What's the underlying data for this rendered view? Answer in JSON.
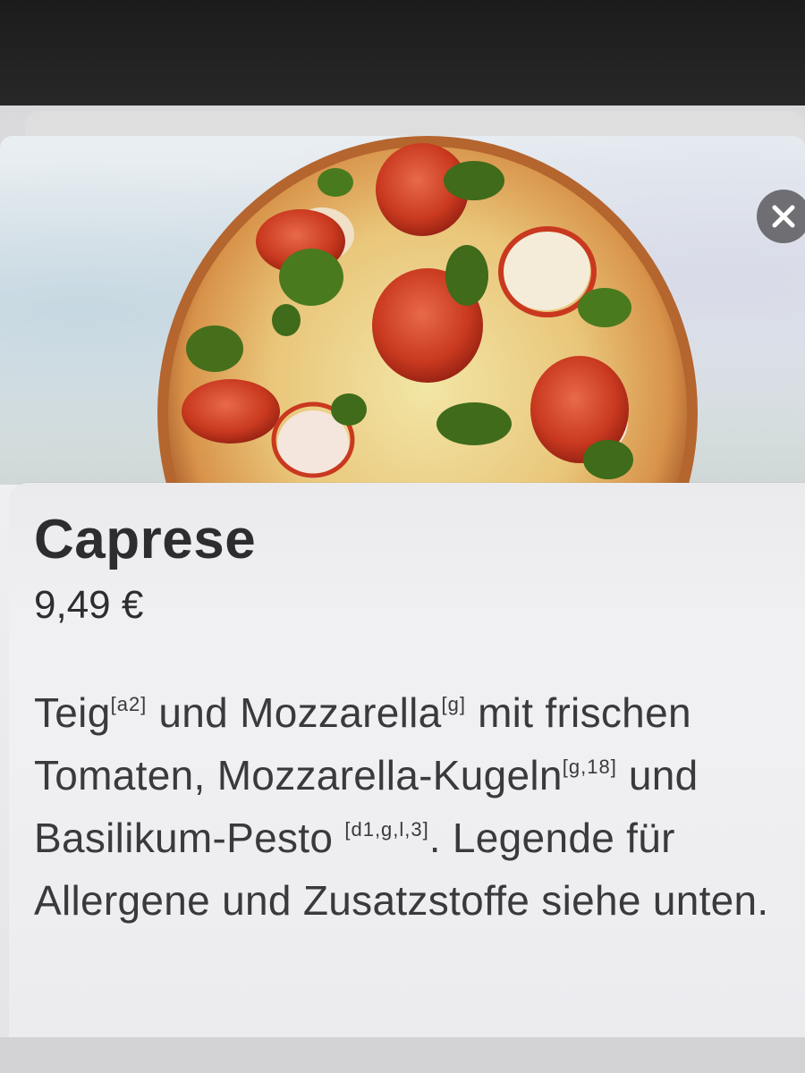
{
  "product": {
    "name": "Caprese",
    "price": "9,49 €",
    "description": [
      {
        "text": "Teig"
      },
      {
        "sup": "[a2]"
      },
      {
        "text": " und Mozzarella"
      },
      {
        "sup": "[g]"
      },
      {
        "text": " mit frischen Tomaten, Mozzarella-Kugeln"
      },
      {
        "sup": "[g,18]"
      },
      {
        "text": " und Basilikum-Pesto "
      },
      {
        "sup": "[d1,g,l,3]"
      },
      {
        "text": ". Legende für Allergene und Zusatzstoffe siehe unten."
      }
    ]
  },
  "icons": {
    "close": "close-icon",
    "photo": "pizza-photo"
  },
  "colors": {
    "tomato": "#c9391f",
    "pesto": "#3f6b1a",
    "crust": "#c98a4a",
    "close_button": "#6f6f73",
    "text": "#2d2d2f"
  }
}
